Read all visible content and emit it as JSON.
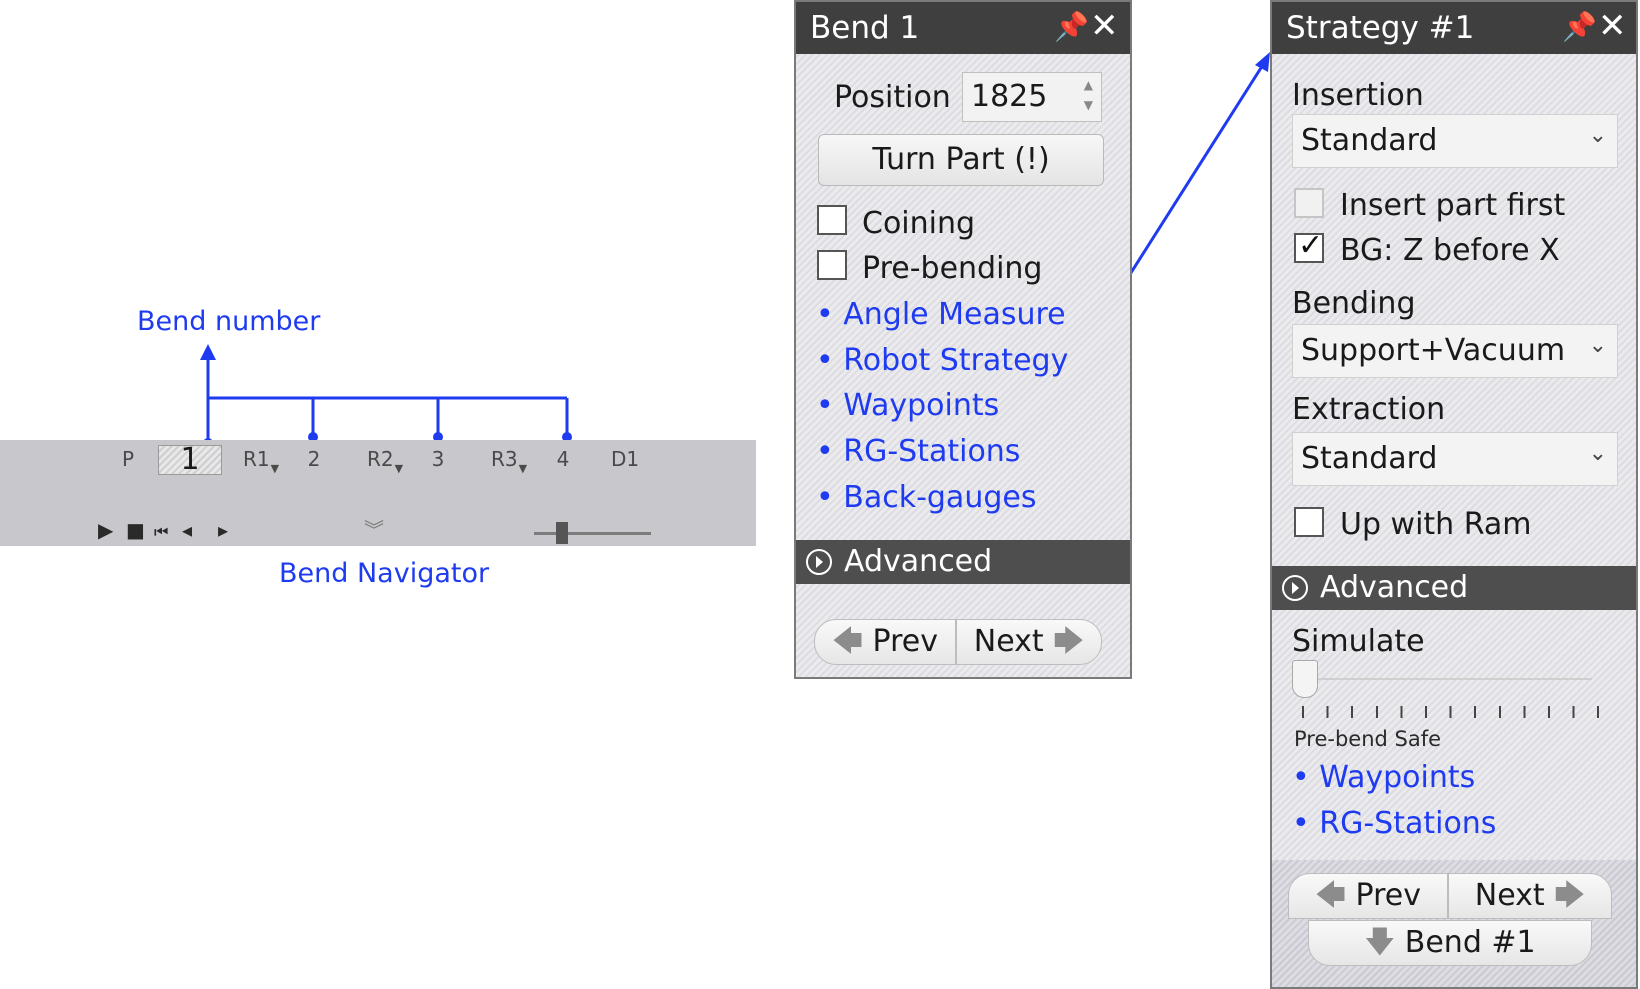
{
  "annotations": {
    "bend_number": "Bend number",
    "bend_navigator": "Bend Navigator"
  },
  "navigator": {
    "tabs": [
      "P",
      "1",
      "R1",
      "2",
      "R2",
      "3",
      "R3",
      "4",
      "D1"
    ],
    "selected_tab": "1",
    "controls": {
      "play": "▶",
      "stop": "■",
      "first": "⏮",
      "prev": "◂",
      "next": "▸",
      "collapse": "︾"
    },
    "speed_slider_level": 0.22
  },
  "bend_panel": {
    "title": "Bend 1",
    "position_label": "Position",
    "position_value": "1825",
    "turn_part_label": "Turn Part (!)",
    "checkboxes": [
      {
        "label": "Coining",
        "checked": false
      },
      {
        "label": "Pre-bending",
        "checked": false
      }
    ],
    "links": [
      "Angle Measure",
      "Robot Strategy",
      "Waypoints",
      "RG-Stations",
      "Back-gauges"
    ],
    "advanced_label": "Advanced",
    "prev_label": "Prev",
    "next_label": "Next"
  },
  "strategy_panel": {
    "title": "Strategy #1",
    "insertion_label": "Insertion",
    "insertion_value": "Standard",
    "insert_part_first_label": "Insert part first",
    "insert_part_first_checked": false,
    "bg_label": "BG: Z before X",
    "bg_checked": true,
    "bending_label": "Bending",
    "bending_value": "Support+Vacuum",
    "extraction_label": "Extraction",
    "extraction_value": "Standard",
    "up_with_ram_label": "Up with Ram",
    "up_with_ram_checked": false,
    "advanced_label": "Advanced",
    "simulate_label": "Simulate",
    "simulate_level": 0,
    "simulate_caption": "Pre-bend Safe",
    "links": [
      "Waypoints",
      "RG-Stations"
    ],
    "prev_label": "Prev",
    "next_label": "Next",
    "bend_label": "Bend #1"
  },
  "colors": {
    "annotation": "#1f3bf0",
    "link": "#1f3bf0",
    "title_bar": "#3f3f3f",
    "advanced_bar": "#4e4e4e",
    "navigator_bg": "#c8c8cc"
  }
}
